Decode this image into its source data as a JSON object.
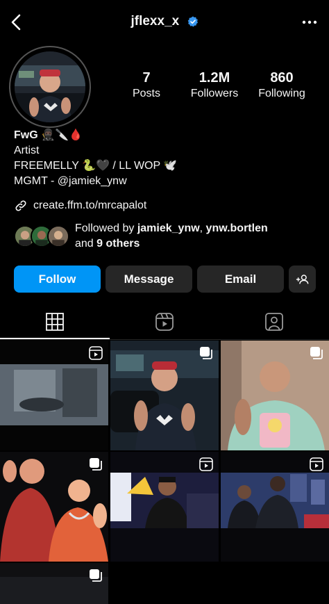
{
  "header": {
    "username": "jflexx_x",
    "verified": true
  },
  "stats": {
    "posts_count": "7",
    "posts_label": "Posts",
    "followers_count": "1.2M",
    "followers_label": "Followers",
    "following_count": "860",
    "following_label": "Following"
  },
  "bio": {
    "name": "FwG 🥷🏿🔪🩸",
    "category": "Artist",
    "line1": "FREEMELLY 🐍🖤 / LL WOP 🕊️",
    "line2": "MGMT - @jamiek_ynw",
    "link": "create.ffm.to/mrcapalot"
  },
  "followed_by": {
    "prefix": "Followed by ",
    "user1": "jamiek_ynw",
    "separator": ", ",
    "user2": "ynw.bortlen",
    "middle": "and ",
    "others": "9 others"
  },
  "actions": {
    "follow_label": "Follow",
    "message_label": "Message",
    "email_label": "Email"
  },
  "tabs": [
    {
      "name": "posts-grid",
      "icon": "grid-icon",
      "active": true
    },
    {
      "name": "reels",
      "icon": "reels-icon",
      "active": false
    },
    {
      "name": "tagged",
      "icon": "tagged-icon",
      "active": false
    }
  ],
  "grid_badges": [
    "reel",
    "carousel",
    "carousel",
    "carousel",
    "reel",
    "reel",
    "carousel"
  ],
  "colors": {
    "accent": "#0095f6",
    "button_bg": "#262626",
    "verified": "#3897f0"
  }
}
